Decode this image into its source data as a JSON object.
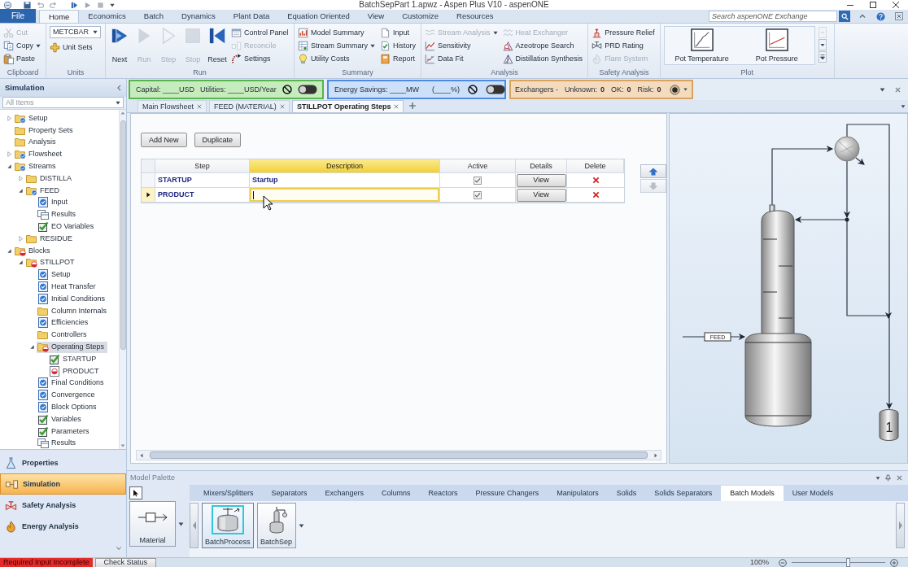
{
  "window": {
    "title": "BatchSepPart 1.apwz - Aspen Plus V10 - aspenONE"
  },
  "ribbon_tabs": [
    {
      "label": "File",
      "kind": "file",
      "selected": false
    },
    {
      "label": "Home",
      "kind": "tab",
      "selected": true
    },
    {
      "label": "Economics",
      "kind": "tab",
      "selected": false
    },
    {
      "label": "Batch",
      "kind": "tab",
      "selected": false
    },
    {
      "label": "Dynamics",
      "kind": "tab",
      "selected": false
    },
    {
      "label": "Plant Data",
      "kind": "tab",
      "selected": false
    },
    {
      "label": "Equation Oriented",
      "kind": "tab",
      "selected": false
    },
    {
      "label": "View",
      "kind": "tab",
      "selected": false
    },
    {
      "label": "Customize",
      "kind": "tab",
      "selected": false
    },
    {
      "label": "Resources",
      "kind": "tab",
      "selected": false
    }
  ],
  "search": {
    "placeholder": "Search aspenONE Exchange"
  },
  "ribbon_groups": [
    {
      "label": "Clipboard",
      "kind": "buttons",
      "columns": [
        [
          {
            "label": "Cut",
            "kind": "small",
            "disabled": true
          },
          {
            "label": "Copy",
            "kind": "small",
            "disabled": false,
            "dropdown": true
          },
          {
            "label": "Paste",
            "kind": "small",
            "disabled": false
          }
        ]
      ]
    },
    {
      "label": "Units",
      "kind": "buttons",
      "columns": [
        [
          {
            "kind": "select",
            "value": "METCBAR"
          },
          {
            "label": "Unit Sets",
            "kind": "small",
            "disabled": false
          }
        ]
      ]
    },
    {
      "label": "Run",
      "kind": "buttons",
      "columns": [
        [
          {
            "label": "Next",
            "kind": "large",
            "disabled": false
          }
        ],
        [
          {
            "label": "Run",
            "kind": "large",
            "disabled": true
          }
        ],
        [
          {
            "label": "Step",
            "kind": "large",
            "disabled": true
          }
        ],
        [
          {
            "label": "Stop",
            "kind": "large",
            "disabled": true
          }
        ],
        [
          {
            "label": "Reset",
            "kind": "large",
            "disabled": false
          }
        ],
        [
          {
            "label": "Control Panel",
            "kind": "small",
            "disabled": false
          },
          {
            "label": "Reconcile",
            "kind": "small",
            "disabled": true
          },
          {
            "label": "Settings",
            "kind": "small",
            "disabled": false
          }
        ]
      ]
    },
    {
      "label": "Summary",
      "kind": "buttons",
      "columns": [
        [
          {
            "label": "Model Summary",
            "kind": "small",
            "disabled": false
          },
          {
            "label": "Stream Summary",
            "kind": "small",
            "disabled": false,
            "dropdown": true
          },
          {
            "label": "Utility Costs",
            "kind": "small",
            "disabled": false
          }
        ],
        [
          {
            "label": "Input",
            "kind": "small",
            "disabled": false
          },
          {
            "label": "History",
            "kind": "small",
            "disabled": false
          },
          {
            "label": "Report",
            "kind": "small",
            "disabled": false
          }
        ]
      ]
    },
    {
      "label": "Analysis",
      "kind": "buttons",
      "columns": [
        [
          {
            "label": "Stream Analysis",
            "kind": "small",
            "disabled": true,
            "dropdown": true
          },
          {
            "label": "Sensitivity",
            "kind": "small",
            "disabled": false
          },
          {
            "label": "Data Fit",
            "kind": "small",
            "disabled": false
          }
        ],
        [
          {
            "label": "Heat Exchanger",
            "kind": "small",
            "disabled": true
          },
          {
            "label": "Azeotrope Search",
            "kind": "small",
            "disabled": false
          },
          {
            "label": "Distillation Synthesis",
            "kind": "small",
            "disabled": false
          }
        ]
      ]
    },
    {
      "label": "Safety Analysis",
      "kind": "buttons",
      "columns": [
        [
          {
            "label": "Pressure Relief",
            "kind": "small",
            "disabled": false
          },
          {
            "label": "PRD Rating",
            "kind": "small",
            "disabled": false
          },
          {
            "label": "Flare System",
            "kind": "small",
            "disabled": true
          }
        ]
      ]
    },
    {
      "label": "Plot",
      "kind": "gallery",
      "columns": [
        [
          {
            "label": "Pot Temperature",
            "kind": "plot"
          }
        ],
        [
          {
            "label": "Pot Pressure",
            "kind": "plot"
          }
        ]
      ]
    }
  ],
  "sidebar": {
    "title": "Simulation",
    "filter": "All Items",
    "tree": [
      {
        "label": "Setup",
        "kind": "checkedfolder",
        "expanded": false,
        "selected": false
      },
      {
        "label": "Property Sets",
        "kind": "folder",
        "selected": false
      },
      {
        "label": "Analysis",
        "kind": "folder",
        "selected": false
      },
      {
        "label": "Flowsheet",
        "kind": "checkedfolder",
        "expanded": false,
        "selected": false
      },
      {
        "label": "Streams",
        "kind": "checkedfolder",
        "expanded": true,
        "selected": false,
        "children": [
          {
            "label": "DISTILLA",
            "kind": "folder",
            "expanded": false,
            "selected": false
          },
          {
            "label": "FEED",
            "kind": "checkedfolder",
            "expanded": true,
            "selected": false,
            "children": [
              {
                "label": "Input",
                "kind": "checkedform",
                "selected": false
              },
              {
                "label": "Results",
                "kind": "results",
                "selected": false
              },
              {
                "label": "EO Variables",
                "kind": "tickform",
                "selected": false
              }
            ]
          },
          {
            "label": "RESIDUE",
            "kind": "folder",
            "expanded": false,
            "selected": false
          }
        ]
      },
      {
        "label": "Blocks",
        "kind": "incompletefolder",
        "expanded": true,
        "selected": false,
        "children": [
          {
            "label": "STILLPOT",
            "kind": "incompletefolder",
            "expanded": true,
            "selected": false,
            "children": [
              {
                "label": "Setup",
                "kind": "checkedform",
                "selected": false
              },
              {
                "label": "Heat Transfer",
                "kind": "checkedform",
                "selected": false
              },
              {
                "label": "Initial Conditions",
                "kind": "checkedform",
                "selected": false
              },
              {
                "label": "Column Internals",
                "kind": "folder",
                "selected": false
              },
              {
                "label": "Efficiencies",
                "kind": "checkedform",
                "selected": false
              },
              {
                "label": "Controllers",
                "kind": "folder",
                "selected": false
              },
              {
                "label": "Operating Steps",
                "kind": "incompletefolder",
                "expanded": true,
                "selected": true,
                "children": [
                  {
                    "label": "STARTUP",
                    "kind": "tickform",
                    "selected": false
                  },
                  {
                    "label": "PRODUCT",
                    "kind": "incompleteform",
                    "selected": false
                  }
                ]
              },
              {
                "label": "Final Conditions",
                "kind": "checkedform",
                "selected": false
              },
              {
                "label": "Convergence",
                "kind": "checkedform",
                "selected": false
              },
              {
                "label": "Block Options",
                "kind": "checkedform",
                "selected": false
              },
              {
                "label": "Variables",
                "kind": "tickform",
                "selected": false
              },
              {
                "label": "Parameters",
                "kind": "tickform",
                "selected": false
              },
              {
                "label": "Results",
                "kind": "results",
                "selected": false
              }
            ]
          }
        ]
      }
    ],
    "nav": [
      {
        "label": "Properties",
        "selected": false
      },
      {
        "label": "Simulation",
        "selected": true
      },
      {
        "label": "Safety Analysis",
        "selected": false
      },
      {
        "label": "Energy Analysis",
        "selected": false
      }
    ]
  },
  "economics": {
    "capital": "Capital: ____USD",
    "utilities": "Utilities: ____USD/Year",
    "on": false
  },
  "energy": {
    "savings": "Energy Savings: ____MW",
    "percent": "(____%)",
    "on": false
  },
  "exchangers": {
    "label": "Exchangers -",
    "stats": [
      {
        "label": "Unknown:",
        "value": "0"
      },
      {
        "label": "OK:",
        "value": "0"
      },
      {
        "label": "Risk:",
        "value": "0"
      }
    ]
  },
  "document_tabs": [
    {
      "label": "Main Flowsheet",
      "selected": false
    },
    {
      "label": "FEED (MATERIAL)",
      "selected": false
    },
    {
      "label": "STILLPOT Operating Steps",
      "selected": true
    }
  ],
  "form": {
    "buttons": [
      "Add New",
      "Duplicate"
    ],
    "table": {
      "columns": [
        {
          "label": "Step",
          "selected": false
        },
        {
          "label": "Description",
          "selected": true
        },
        {
          "label": "Active",
          "selected": false
        },
        {
          "label": "Details",
          "selected": false
        },
        {
          "label": "Delete",
          "selected": false
        }
      ],
      "rows": [
        {
          "step": "STARTUP",
          "description": "Startup",
          "active": true,
          "details": "View",
          "selected": false
        },
        {
          "step": "PRODUCT",
          "active": true,
          "details": "View",
          "selected": true
        }
      ]
    }
  },
  "flowsheet": {
    "feed_label": "FEED",
    "receiver_label": "1"
  },
  "model_palette": {
    "title": "Model Palette",
    "tabs": [
      {
        "label": "Mixers/Splitters",
        "selected": false
      },
      {
        "label": "Separators",
        "selected": false
      },
      {
        "label": "Exchangers",
        "selected": false
      },
      {
        "label": "Columns",
        "selected": false
      },
      {
        "label": "Reactors",
        "selected": false
      },
      {
        "label": "Pressure Changers",
        "selected": false
      },
      {
        "label": "Manipulators",
        "selected": false
      },
      {
        "label": "Solids",
        "selected": false
      },
      {
        "label": "Solids Separators",
        "selected": false
      },
      {
        "label": "Batch Models",
        "selected": true
      },
      {
        "label": "User Models",
        "selected": false
      }
    ],
    "items": [
      {
        "label": "Material",
        "kind": "stream",
        "selected": false,
        "dropdown": true
      },
      {
        "label": "BatchProcess",
        "kind": "model",
        "selected": true
      },
      {
        "label": "BatchSep",
        "kind": "model",
        "selected": false,
        "dropdown": true
      }
    ]
  },
  "status_bar": {
    "message": "Required Input Incomplete",
    "button": "Check Status",
    "zoom": "100%",
    "level": 0.6
  }
}
